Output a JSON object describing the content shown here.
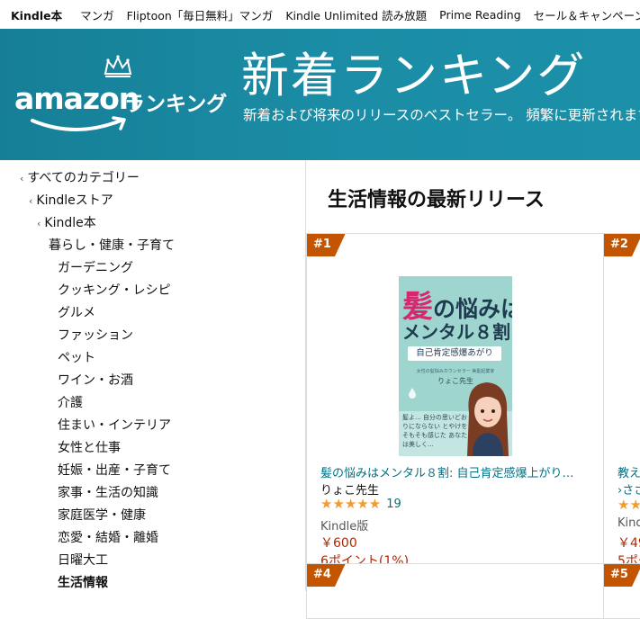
{
  "topnav": {
    "items": [
      "Kindle本",
      "マンガ",
      "Fliptoon「毎日無料」マンガ",
      "Kindle Unlimited 読み放題",
      "Prime Reading",
      "セール＆キャンペーン"
    ]
  },
  "banner": {
    "brand_amazon": "amazon",
    "brand_ranking": "ランキング",
    "title": "新着ランキング",
    "subtitle": "新着および将来のリリースのベストセラー。 頻繁に更新されます。",
    "bg_color": "#1b8da6"
  },
  "sidebar": {
    "categories": [
      "すべてのカテゴリー",
      "Kindleストア",
      "Kindle本",
      "暮らし・健康・子育て",
      "ガーデニング",
      "クッキング・レシピ",
      "グルメ",
      "ファッション",
      "ペット",
      "ワイン・お酒",
      "介護",
      "住まい・インテリア",
      "女性と仕事",
      "妊娠・出産・子育て",
      "家事・生活の知識",
      "家庭医学・健康",
      "恋愛・結婚・離婚",
      "日曜大工",
      "生活情報"
    ]
  },
  "main": {
    "section_title": "生活情報の最新リリース",
    "accent_color": "#c45500",
    "cards": [
      {
        "rank": "#1",
        "cover": {
          "line1_pink": "髪",
          "line1_rest": "の悩みは",
          "line2": "メンタル８割",
          "line3": "自己肯定感爆あがり",
          "line4": "女性の髪悩みカウンセラー 美髪起業家",
          "author": "りょこ先生",
          "quote": "髪よ... 自分の思いどおりにならない とやけをそもそも感じた あなたは美しく..."
        },
        "title": "髪の悩みはメンタル８割: 自己肯定感爆上がり…",
        "author": "りょこ先生",
        "stars": "★★★★★",
        "rating": 5,
        "review_count": "19",
        "format": "Kindle版",
        "price": "￥600",
        "points": "6ポイント(1%)"
      },
      {
        "rank": "#2",
        "title": "教え",
        "subtitle": "›ささ",
        "stars": "★★",
        "format": "Kind",
        "price": "￥49",
        "points": "5ポー"
      },
      {
        "rank": "#4"
      },
      {
        "rank": "#5"
      }
    ]
  }
}
